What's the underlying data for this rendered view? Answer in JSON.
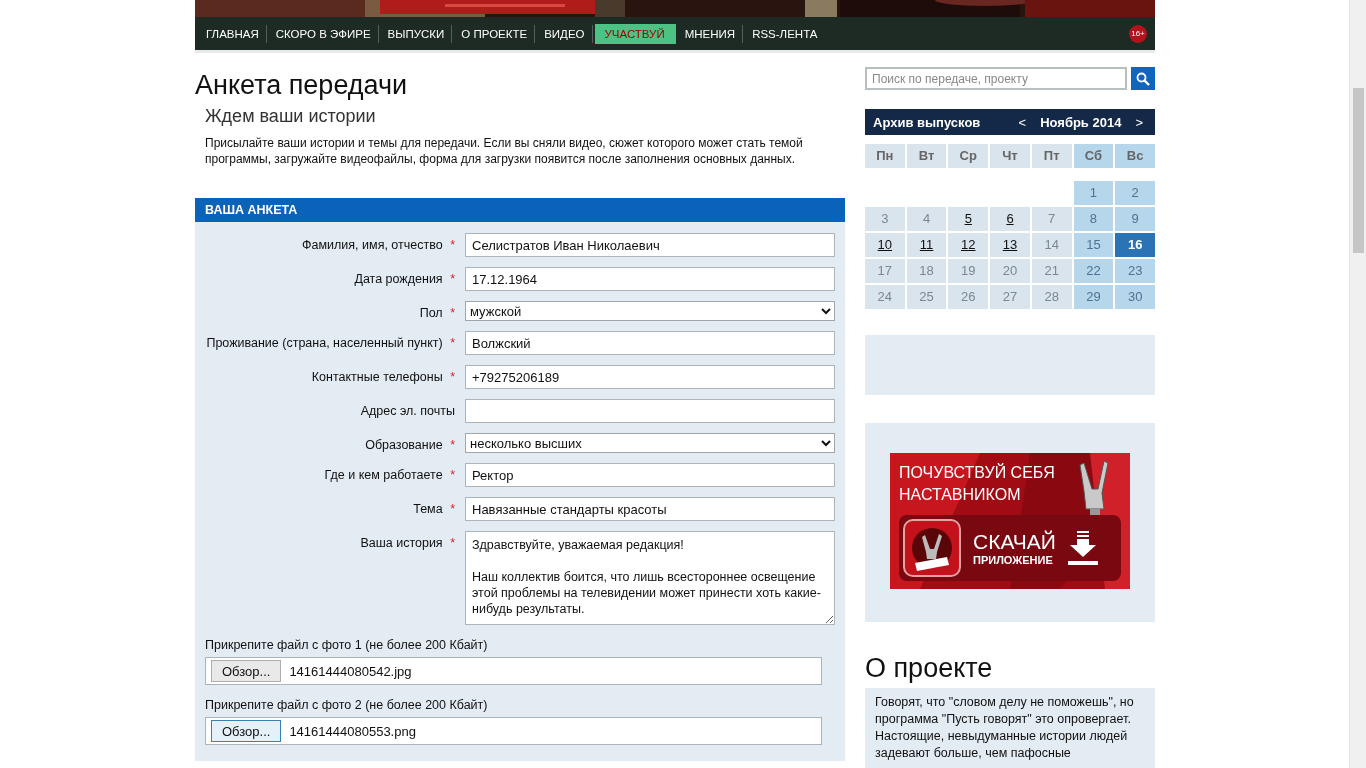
{
  "header": {
    "nav": [
      {
        "label": "ГЛАВНАЯ",
        "selected": false
      },
      {
        "label": "СКОРО В ЭФИРЕ",
        "selected": false
      },
      {
        "label": "ВЫПУСКИ",
        "selected": false
      },
      {
        "label": "О ПРОЕКТЕ",
        "selected": false
      },
      {
        "label": "ВИДЕО",
        "selected": false
      },
      {
        "label": "УЧАСТВУЙ",
        "selected": true
      },
      {
        "label": "МНЕНИЯ",
        "selected": false
      },
      {
        "label": "RSS-ЛЕНТА",
        "selected": false
      }
    ],
    "age_badge": "16+"
  },
  "main": {
    "title": "Анкета передачи",
    "subtitle": "Ждем ваши истории",
    "intro": "Присылайте ваши истории и темы для передачи. Если вы сняли видео, сюжет которого может стать темой программы, загружайте видеофайлы, форма для загрузки появится после заполнения основных данных.",
    "form": {
      "title": "ВАША АНКЕТА",
      "required_mark": "*",
      "fields": [
        {
          "kind": "text",
          "label": "Фамилия, имя, отчество",
          "required": true,
          "value": "Селистратов Иван Николаевич"
        },
        {
          "kind": "text",
          "label": "Дата рождения",
          "required": true,
          "value": "17.12.1964"
        },
        {
          "kind": "select",
          "label": "Пол",
          "required": true,
          "value": "мужской"
        },
        {
          "kind": "text",
          "label": "Проживание (страна, населенный пункт)",
          "required": true,
          "value": "Волжский"
        },
        {
          "kind": "text",
          "label": "Контактные телефоны",
          "required": true,
          "value": "+79275206189"
        },
        {
          "kind": "text",
          "label": "Адрес эл. почты",
          "required": false
        },
        {
          "kind": "select",
          "label": "Образование",
          "required": true,
          "value": "несколько высших"
        },
        {
          "kind": "text",
          "label": "Где и кем работаете",
          "required": true,
          "value": "Ректор"
        },
        {
          "kind": "text",
          "label": "Тема",
          "required": true,
          "value": "Навязанные стандарты красоты"
        },
        {
          "kind": "textarea",
          "label": "Ваша история",
          "required": true,
          "value": "Здравствуйте, уважаемая редакция!\n\nНаш коллектив боится, что лишь всестороннее освещение этой проблемы на телевидении может принести хоть какие-нибудь результаты."
        }
      ],
      "files": [
        {
          "label": "Прикрепите файл с фото 1 (не более 200 Кбайт)",
          "button": "Обзор...",
          "file": "14161444080542.jpg",
          "focused": false
        },
        {
          "label": "Прикрепите файл с фото 2 (не более 200 Кбайт)",
          "button": "Обзор...",
          "file": "14161444080553.png",
          "focused": true
        }
      ]
    }
  },
  "sidebar": {
    "search": {
      "placeholder": "Поиск по передаче, проекту"
    },
    "calendar": {
      "title": "Архив выпусков",
      "prev": "<",
      "month": "Ноябрь 2014",
      "next": ">",
      "weekdays": [
        "Пн",
        "Вт",
        "Ср",
        "Чт",
        "Пт",
        "Сб",
        "Вс"
      ],
      "weeks": [
        [
          {
            "kind": "blank"
          },
          {
            "kind": "blank"
          },
          {
            "kind": "blank"
          },
          {
            "kind": "blank"
          },
          {
            "kind": "blank"
          },
          {
            "kind": "day",
            "day": "1",
            "has_issue": false,
            "selected": false
          },
          {
            "kind": "day",
            "day": "2",
            "has_issue": false,
            "selected": false
          }
        ],
        [
          {
            "kind": "day",
            "day": "3",
            "has_issue": false,
            "selected": false
          },
          {
            "kind": "day",
            "day": "4",
            "has_issue": false,
            "selected": false
          },
          {
            "kind": "day",
            "day": "5",
            "has_issue": true,
            "selected": false
          },
          {
            "kind": "day",
            "day": "6",
            "has_issue": true,
            "selected": false
          },
          {
            "kind": "day",
            "day": "7",
            "has_issue": false,
            "selected": false
          },
          {
            "kind": "day",
            "day": "8",
            "has_issue": false,
            "selected": false
          },
          {
            "kind": "day",
            "day": "9",
            "has_issue": false,
            "selected": false
          }
        ],
        [
          {
            "kind": "day",
            "day": "10",
            "has_issue": true,
            "selected": false
          },
          {
            "kind": "day",
            "day": "11",
            "has_issue": true,
            "selected": false
          },
          {
            "kind": "day",
            "day": "12",
            "has_issue": true,
            "selected": false
          },
          {
            "kind": "day",
            "day": "13",
            "has_issue": true,
            "selected": false
          },
          {
            "kind": "day",
            "day": "14",
            "has_issue": false,
            "selected": false
          },
          {
            "kind": "day",
            "day": "15",
            "has_issue": false,
            "selected": false
          },
          {
            "kind": "day",
            "day": "16",
            "has_issue": false,
            "selected": true
          }
        ],
        [
          {
            "kind": "day",
            "day": "17",
            "has_issue": false,
            "selected": false
          },
          {
            "kind": "day",
            "day": "18",
            "has_issue": false,
            "selected": false
          },
          {
            "kind": "day",
            "day": "19",
            "has_issue": false,
            "selected": false
          },
          {
            "kind": "day",
            "day": "20",
            "has_issue": false,
            "selected": false
          },
          {
            "kind": "day",
            "day": "21",
            "has_issue": false,
            "selected": false
          },
          {
            "kind": "day",
            "day": "22",
            "has_issue": false,
            "selected": false
          },
          {
            "kind": "day",
            "day": "23",
            "has_issue": false,
            "selected": false
          }
        ],
        [
          {
            "kind": "day",
            "day": "24",
            "has_issue": false,
            "selected": false
          },
          {
            "kind": "day",
            "day": "25",
            "has_issue": false,
            "selected": false
          },
          {
            "kind": "day",
            "day": "26",
            "has_issue": false,
            "selected": false
          },
          {
            "kind": "day",
            "day": "27",
            "has_issue": false,
            "selected": false
          },
          {
            "kind": "day",
            "day": "28",
            "has_issue": false,
            "selected": false
          },
          {
            "kind": "day",
            "day": "29",
            "has_issue": false,
            "selected": false
          },
          {
            "kind": "day",
            "day": "30",
            "has_issue": false,
            "selected": false
          }
        ]
      ]
    },
    "ad": {
      "headline": "ПОЧУВСТВУЙ СЕБЯ НАСТАВНИКОМ",
      "action": "СКАЧАЙ",
      "action_sub": "ПРИЛОЖЕНИЕ"
    },
    "about": {
      "title": "О проекте",
      "text": "Говорят, что \"словом делу не поможешь\", но программа \"Пусть говорят\" это опровергает. Настоящие, невыдуманные истории людей задевают больше, чем пафосные"
    }
  }
}
